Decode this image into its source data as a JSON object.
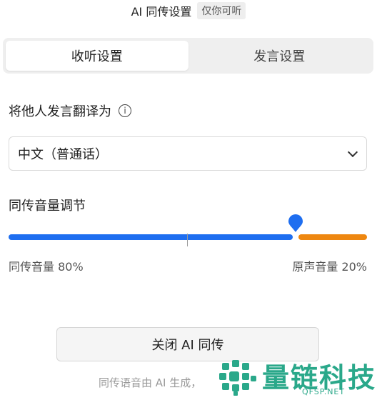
{
  "header": {
    "title": "AI 同传设置",
    "badge": "仅你可听"
  },
  "tabs": [
    {
      "label": "收听设置",
      "active": true
    },
    {
      "label": "发言设置",
      "active": false
    }
  ],
  "translate_section": {
    "label": "将他人发言翻译为",
    "selected_language": "中文（普通话）"
  },
  "volume_section": {
    "title": "同传音量调节",
    "interpretation_volume_label": "同传音量 80%",
    "original_volume_label": "原声音量 20%",
    "interpretation_volume": 0.8,
    "colors": {
      "interpretation": "#1e6ef0",
      "original": "#ee8710"
    }
  },
  "close_button": {
    "label": "关闭 AI 同传"
  },
  "footer": {
    "note": "同传语音由 AI 生成，"
  },
  "watermark": {
    "name": "量链科技",
    "site": "QFSP.NET",
    "color": "#2aa88a"
  }
}
